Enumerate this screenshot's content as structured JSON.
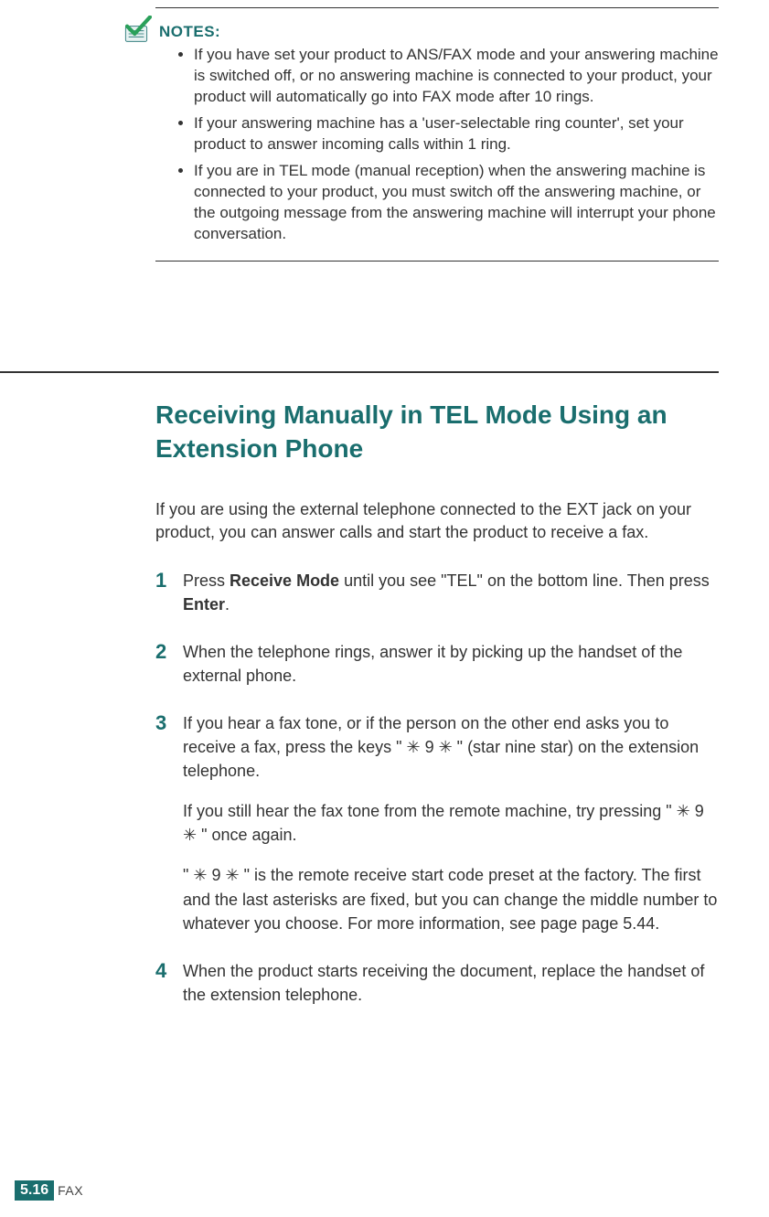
{
  "notes": {
    "title": "NOTES:",
    "items": [
      "If you have set your product to ANS/FAX mode and your answering machine is switched off, or no answering machine is connected to your product, your product will automatically go into FAX mode after 10 rings.",
      "If your answering machine has a 'user-selectable ring counter', set your product to answer incoming calls within 1 ring.",
      "If you are in TEL mode (manual reception) when the answering machine is connected to your product, you must switch off the answering machine, or the outgoing message from the answering machine will interrupt your phone conversation."
    ]
  },
  "section": {
    "heading": "Receiving Manually in TEL Mode Using an Extension Phone",
    "intro": "If you are using the external telephone connected to the EXT jack on your product, you can answer calls and start the product to receive a fax.",
    "steps": [
      {
        "num": "1",
        "p1a": "Press ",
        "p1b": "Receive Mode",
        "p1c": " until you see \"TEL\" on the bottom line. Then press ",
        "p1d": "Enter",
        "p1e": "."
      },
      {
        "num": "2",
        "p1": "When the telephone rings, answer it by picking up the handset of the external phone."
      },
      {
        "num": "3",
        "p1": "If you hear a fax tone, or if the person on the other end asks you to receive a fax, press the keys \" ✳ 9  ✳ \" (star nine star) on the extension telephone.",
        "p2": "If you still hear the fax tone from the remote machine, try pressing \" ✳ 9  ✳ \" once again.",
        "p3": "\" ✳ 9  ✳ \" is the remote receive start code preset at the factory. The first and the last asterisks are fixed, but you can change the middle number to whatever you choose. For more information, see page page 5.44."
      },
      {
        "num": "4",
        "p1": "When the product starts receiving the document, replace the handset of the extension telephone."
      }
    ]
  },
  "footer": {
    "page": "5.16",
    "label": "FAX"
  }
}
